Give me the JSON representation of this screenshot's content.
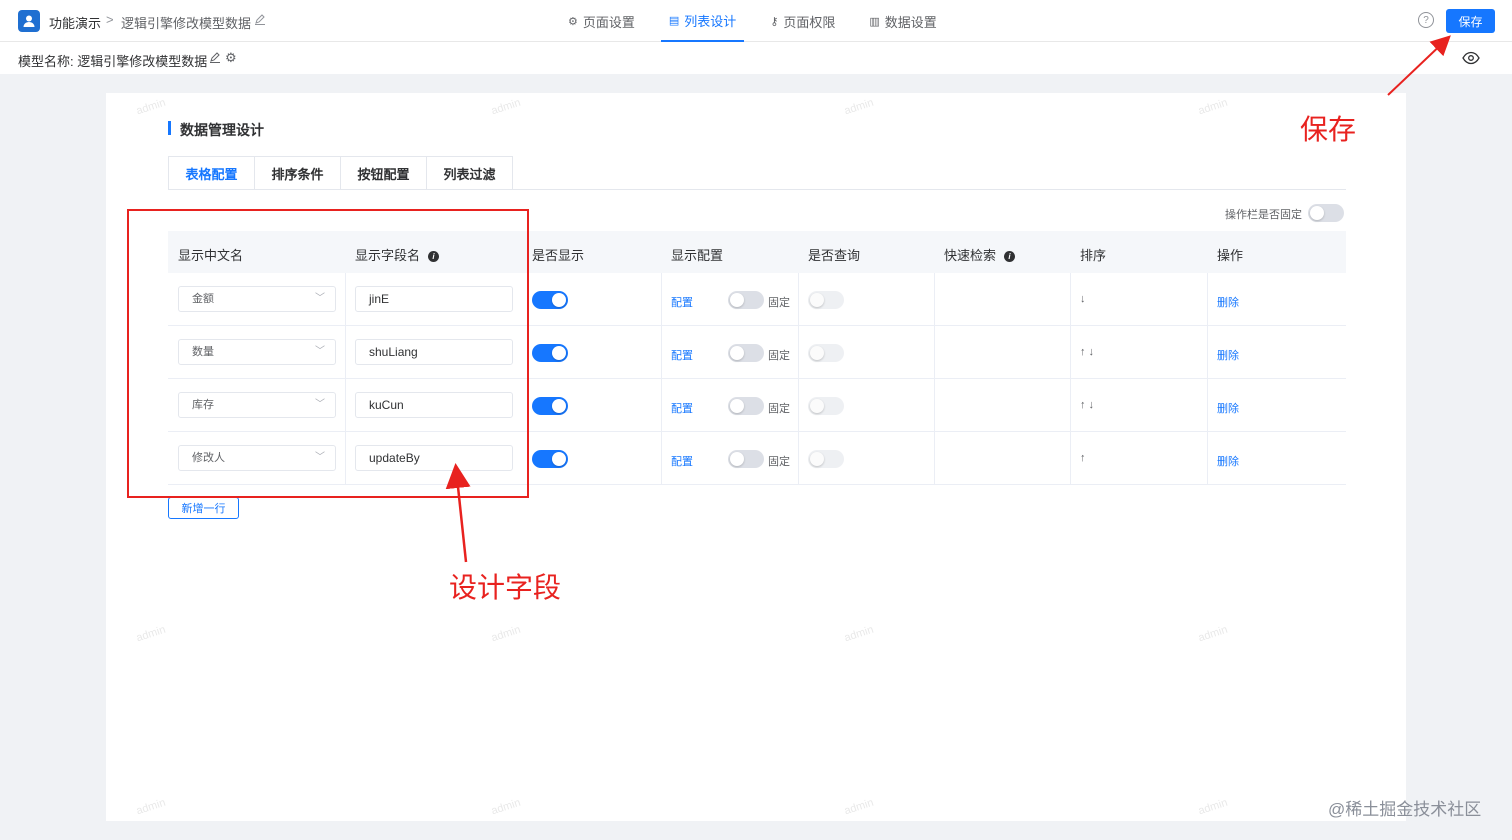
{
  "header": {
    "app_name": "功能演示",
    "breadcrumb_sep": ">",
    "model_title": "逻辑引擎修改模型数据",
    "tabs": [
      {
        "label": "页面设置",
        "icon": "gear-icon"
      },
      {
        "label": "列表设计",
        "icon": "list-design-icon"
      },
      {
        "label": "页面权限",
        "icon": "key-icon"
      },
      {
        "label": "数据设置",
        "icon": "bar-chart-icon"
      }
    ],
    "help": "?",
    "save_label": "保存"
  },
  "subheader": {
    "model_label": "模型名称: 逻辑引擎修改模型数据"
  },
  "section": {
    "title": "数据管理设计",
    "tabs": [
      "表格配置",
      "排序条件",
      "按钮配置",
      "列表过滤"
    ]
  },
  "toolbar": {
    "fix_ops_label": "操作栏是否固定"
  },
  "table": {
    "headers": [
      "显示中文名",
      "显示字段名",
      "是否显示",
      "显示配置",
      "是否查询",
      "快速检索",
      "排序",
      "操作"
    ],
    "config_link": "配置",
    "fixed_label": "固定",
    "delete_link": "删除",
    "rows": [
      {
        "cn_name": "金额",
        "field": "jinE",
        "arrows": "↓"
      },
      {
        "cn_name": "数量",
        "field": "shuLiang",
        "arrows": "↑ ↓"
      },
      {
        "cn_name": "库存",
        "field": "kuCun",
        "arrows": "↑ ↓"
      },
      {
        "cn_name": "修改人",
        "field": "updateBy",
        "arrows": "↑"
      }
    ]
  },
  "add_row_label": "新增一行",
  "watermark_text": "admin",
  "annotations": {
    "save": "保存",
    "design_field": "设计字段"
  },
  "footer_watermark": "@稀土掘金技术社区",
  "colors": {
    "accent": "#1677ff",
    "annotation": "#e8221f"
  }
}
